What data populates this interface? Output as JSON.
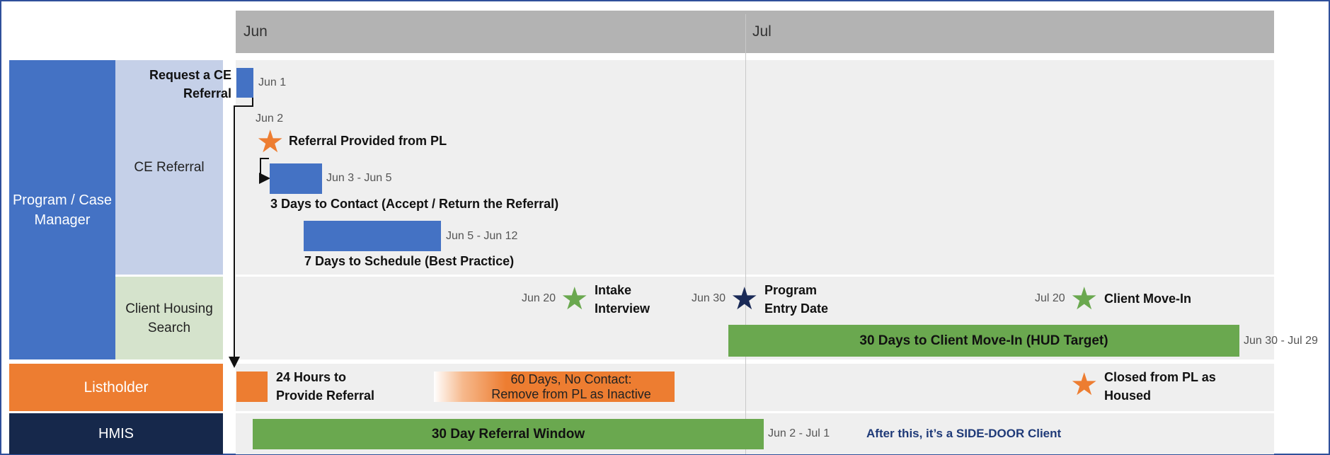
{
  "months": {
    "jun": "Jun",
    "jul": "Jul"
  },
  "lanes": {
    "program_case_manager": "Program / Case Manager",
    "ce_referral": "CE Referral",
    "client_housing_search": "Client Housing Search",
    "listholder": "Listholder",
    "hmis": "HMIS"
  },
  "tasks": {
    "request_ce_referral": {
      "label": "Request a CE Referral",
      "date": "Jun 1"
    },
    "referral_provided": {
      "label": "Referral Provided from PL",
      "date": "Jun 2"
    },
    "three_days_contact": {
      "label": "3 Days to Contact (Accept / Return the Referral)",
      "date": "Jun 3 - Jun 5"
    },
    "seven_days_schedule": {
      "label": "7 Days to Schedule (Best Practice)",
      "date": "Jun 5 - Jun 12"
    },
    "intake_interview": {
      "label": "Intake Interview",
      "date": "Jun 20"
    },
    "program_entry_date": {
      "label": "Program Entry Date",
      "date": "Jun 30"
    },
    "client_move_in": {
      "label": "Client Move-In",
      "date": "Jul 20"
    },
    "thirty_days_move_in": {
      "label": "30 Days to Client Move-In (HUD Target)",
      "date": "Jun 30 - Jul 29"
    },
    "twenty_four_hours": {
      "label": "24 Hours to Provide Referral"
    },
    "sixty_days_no_contact": {
      "label": "60 Days, No Contact: Remove from PL as Inactive"
    },
    "closed_from_pl": {
      "label": "Closed from PL as Housed"
    },
    "thirty_day_window": {
      "label": "30 Day Referral Window",
      "date": "Jun 2 - Jul 1"
    },
    "side_door_note": "After this, it’s a SIDE-DOOR Client"
  },
  "colors": {
    "blue": "#4472c4",
    "green": "#6aa84f",
    "orange": "#ed7d31",
    "navy": "#16284b",
    "star_orange": "#ed7d31",
    "star_green": "#6aa84f",
    "star_navy": "#1a2a57"
  },
  "icons": {
    "milestone": "star-icon"
  }
}
